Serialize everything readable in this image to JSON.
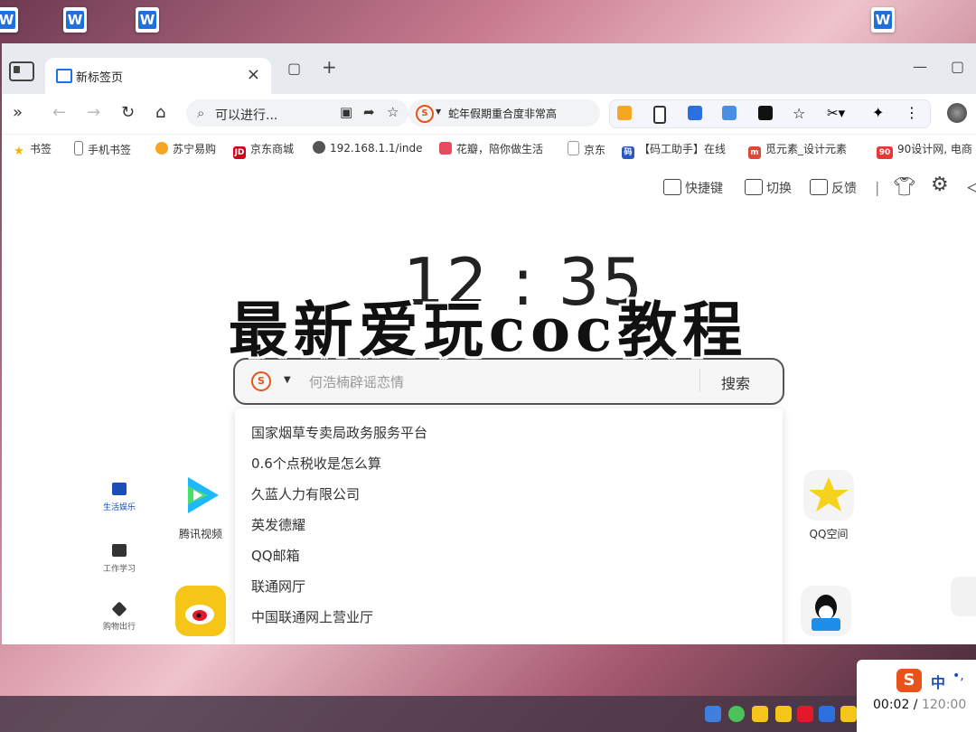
{
  "desktop": {
    "word_icon_glyph": "W"
  },
  "tab": {
    "title": "新标签页",
    "close": "×",
    "new_tab": "+"
  },
  "toolbar": {
    "expand": "»",
    "back": "←",
    "forward": "→",
    "reload": "↻",
    "home": "⌂",
    "address_text": "可以进行...",
    "news_text": "蛇年假期重合度非常高",
    "star": "☆",
    "menu": "⋮"
  },
  "bookmarks": [
    {
      "label": "书签",
      "color": "#f4b400",
      "glyph": "★"
    },
    {
      "label": "手机书签",
      "color": "#777777",
      "glyph": ""
    },
    {
      "label": "苏宁易购",
      "color": "#f5a623",
      "glyph": ""
    },
    {
      "label": "京东商城",
      "color": "#d0021b",
      "glyph": "JD"
    },
    {
      "label": "192.168.1.1/inde",
      "color": "#555555",
      "glyph": ""
    },
    {
      "label": "花瓣，陪你做生活",
      "color": "#e84a5f",
      "glyph": ""
    },
    {
      "label": "京东",
      "color": "#888888",
      "glyph": ""
    },
    {
      "label": "【码工助手】在线",
      "color": "#2b59c3",
      "glyph": "码"
    },
    {
      "label": "觅元素_设计元素",
      "color": "#e0453a",
      "glyph": "m"
    },
    {
      "label": "90设计网, 电商",
      "color": "#e53935",
      "glyph": "90"
    }
  ],
  "topright": {
    "shortcuts": "快捷键",
    "switch": "切换",
    "feedback": "反馈"
  },
  "clock": "12 : 35",
  "overlay_title": "最新爱玩coc教程",
  "search": {
    "engine_glyph": "S",
    "placeholder": "何浩楠辟谣恋情",
    "button": "搜索",
    "suggestions": [
      "国家烟草专卖局政务服务平台",
      "0.6个点税收是怎么算",
      "久蓝人力有限公司",
      "英发德耀",
      "QQ邮箱",
      "联通网厅",
      "中国联通网上营业厅"
    ]
  },
  "nav": [
    {
      "label": "生活娱乐",
      "active": true
    },
    {
      "label": "工作学习",
      "active": false
    },
    {
      "label": "购物出行",
      "active": false
    }
  ],
  "apps": [
    {
      "label": "腾讯视频",
      "color": "#1fb7ff"
    },
    {
      "label": "QQ空间",
      "color": "#f7d21c"
    },
    {
      "label": "",
      "color": "#f5c518"
    },
    {
      "label": "",
      "color": "#1f8ee8"
    }
  ],
  "ime": {
    "logo": "S",
    "lang": "中",
    "dots": "•,",
    "elapsed": "00:02",
    "separator": " / ",
    "total": "120:00"
  }
}
